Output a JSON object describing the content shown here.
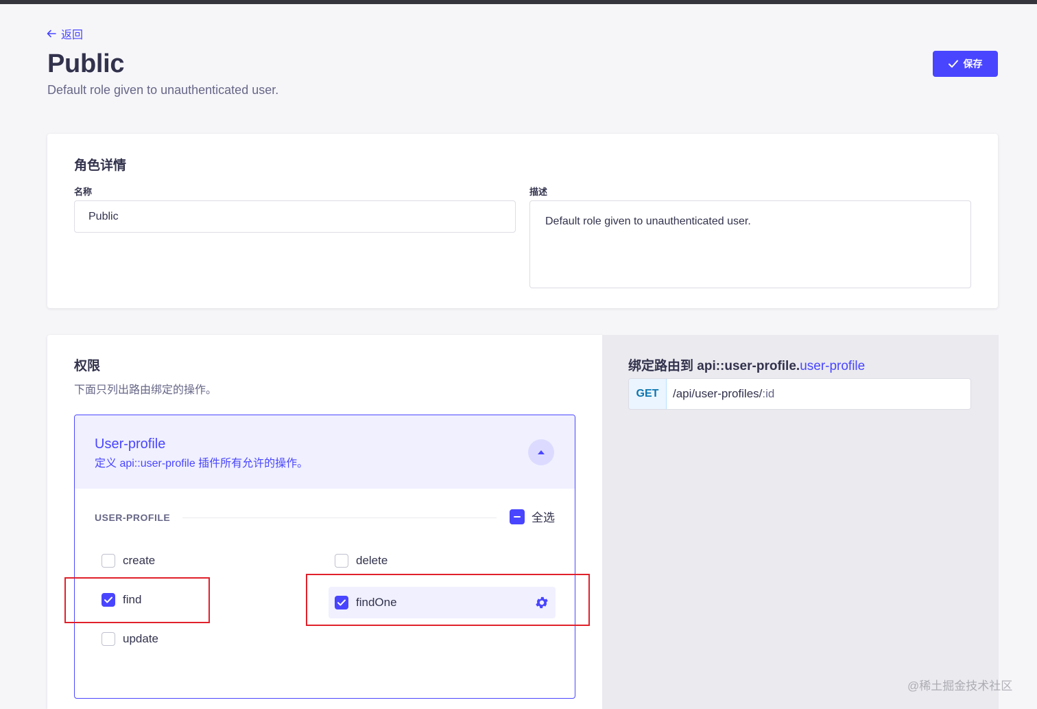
{
  "header": {
    "back_label": "返回",
    "title": "Public",
    "subtitle": "Default role given to unauthenticated user.",
    "save_label": "保存"
  },
  "details": {
    "heading": "角色详情",
    "name_label": "名称",
    "name_value": "Public",
    "description_label": "描述",
    "description_value": "Default role given to unauthenticated user."
  },
  "permissions": {
    "heading": "权限",
    "description": "下面只列出路由绑定的操作。",
    "plugin": {
      "title": "User-profile",
      "description": "定义 api::user-profile 插件所有允许的操作。",
      "group_label": "USER-PROFILE",
      "select_all_label": "全选",
      "select_all_state": "indeterminate",
      "actions": [
        {
          "label": "create",
          "checked": false
        },
        {
          "label": "delete",
          "checked": false
        },
        {
          "label": "find",
          "checked": true
        },
        {
          "label": "findOne",
          "checked": true,
          "selected": true
        },
        {
          "label": "update",
          "checked": false
        }
      ]
    }
  },
  "routes": {
    "title_prefix": "绑定路由到 api::user-profile.",
    "title_accent": "user-profile",
    "method": "GET",
    "path_main": "/api/user-profiles/",
    "path_param": ":id"
  },
  "watermark": "@稀土掘金技术社区",
  "colors": {
    "primary": "#4945ff",
    "highlight_red": "#e0202a",
    "method_blue": "#0c75af"
  }
}
